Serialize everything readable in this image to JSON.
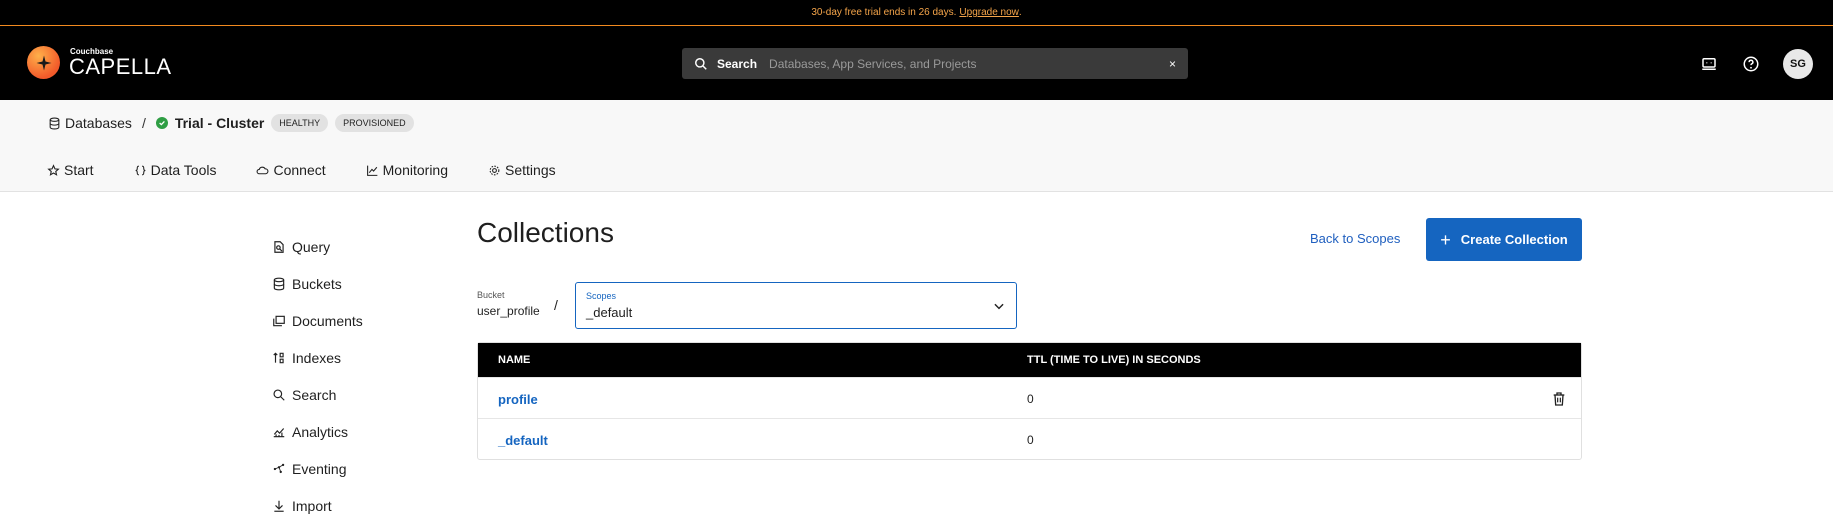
{
  "banner": {
    "text": "30-day free trial ends in 26 days.",
    "link": "Upgrade now",
    "tail": "."
  },
  "brand": {
    "small": "Couchbase",
    "big": "CAPELLA"
  },
  "search": {
    "label": "Search",
    "placeholder": "Databases, App Services, and Projects",
    "clear": "×"
  },
  "user": {
    "initials": "SG"
  },
  "breadcrumb": {
    "root": "Databases",
    "separator": "/",
    "cluster": "Trial - Cluster",
    "badges": [
      "HEALTHY",
      "PROVISIONED"
    ]
  },
  "tabs": [
    "Start",
    "Data Tools",
    "Connect",
    "Monitoring",
    "Settings"
  ],
  "sidebar": {
    "items": [
      "Query",
      "Buckets",
      "Documents",
      "Indexes",
      "Search",
      "Analytics",
      "Eventing",
      "Import"
    ]
  },
  "main": {
    "title": "Collections",
    "back_link": "Back to Scopes",
    "create_button": "Create Collection",
    "bucket_label": "Bucket",
    "bucket_value": "user_profile",
    "slash": "/",
    "scopes_label": "Scopes",
    "scopes_value": "_default"
  },
  "table": {
    "headers": [
      "NAME",
      "TTL (TIME TO LIVE) IN SECONDS"
    ],
    "rows": [
      {
        "name": "profile",
        "ttl": "0",
        "deletable": true
      },
      {
        "name": "_default",
        "ttl": "0",
        "deletable": false
      }
    ]
  },
  "colors": {
    "accent": "#1565c0",
    "banner": "#f28a1f",
    "healthy": "#2f9e44"
  }
}
